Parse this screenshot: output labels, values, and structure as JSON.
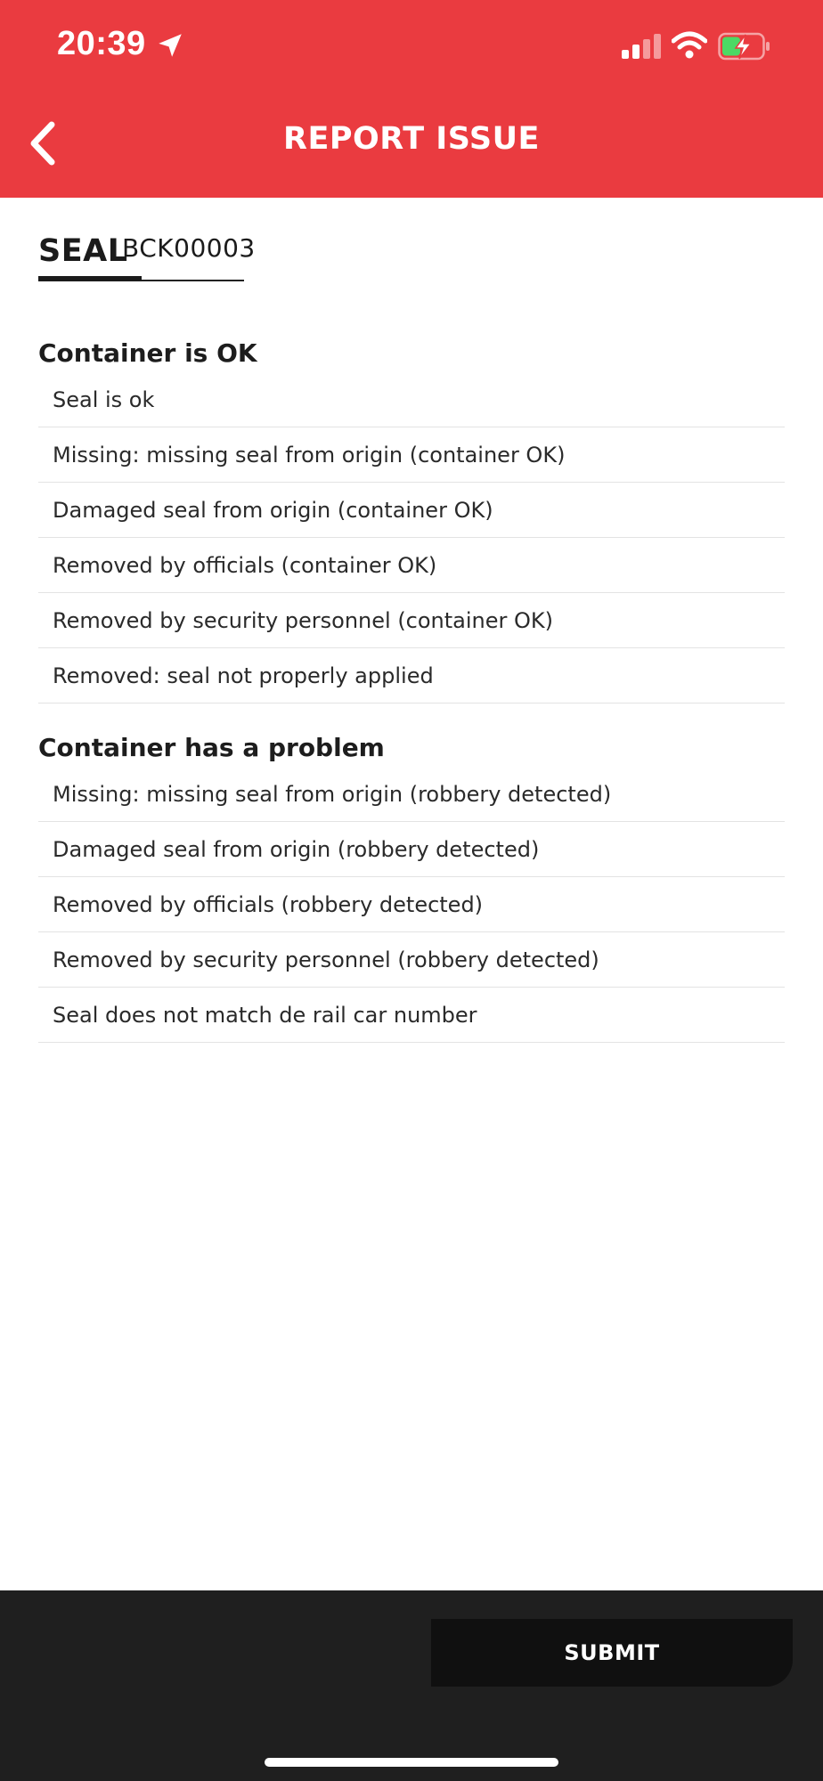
{
  "status_bar": {
    "time": "20:39",
    "icons": [
      "location-arrow-icon",
      "cellular-signal-icon",
      "wifi-icon",
      "battery-charging-icon"
    ]
  },
  "header": {
    "title": "REPORT ISSUE",
    "back_icon": "chevron-left-icon"
  },
  "seal": {
    "label": "SEAL",
    "value": "BCK00003"
  },
  "sections": [
    {
      "heading": "Container is OK",
      "options": [
        "Seal is ok",
        "Missing: missing seal from origin (container OK)",
        "Damaged seal from origin (container OK)",
        "Removed by officials (container OK)",
        "Removed by security personnel (container OK)",
        "Removed: seal not properly applied"
      ]
    },
    {
      "heading": "Container has a problem",
      "options": [
        "Missing: missing seal from origin (robbery detected)",
        "Damaged seal from origin (robbery detected)",
        "Removed by officials (robbery detected)",
        "Removed by security personnel (robbery detected)",
        "Seal does not match de rail car number"
      ]
    }
  ],
  "footer": {
    "submit_label": "SUBMIT"
  },
  "colors": {
    "header_bg": "#ea3b40",
    "footer_bg": "#1f1f1f",
    "submit_bg": "#101010"
  }
}
